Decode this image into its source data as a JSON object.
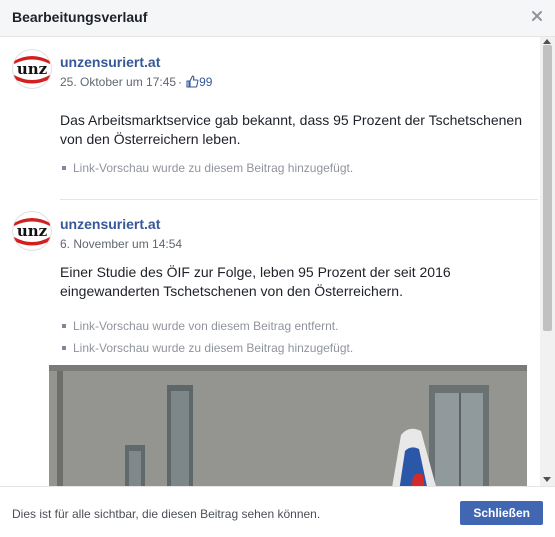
{
  "dialog": {
    "title": "Bearbeitungsverlauf",
    "footer_note": "Dies ist für alle sichtbar, die diesen Beitrag sehen können.",
    "close_label": "Schließen"
  },
  "entries": [
    {
      "author": "unzensuriert.at",
      "avatar_text": "unz",
      "date": "25. Oktober um 17:45",
      "separator": "·",
      "likes": "99",
      "text_lines": [
        "Das Arbeitsmarktservice gab bekannt, dass 95 Prozent der Tschetschenen",
        "von den Österreichern leben."
      ],
      "changes": [
        "Link-Vorschau wurde zu diesem Beitrag hinzugefügt."
      ]
    },
    {
      "author": "unzensuriert.at",
      "avatar_text": "unz",
      "date": "6. November um 14:54",
      "text_lines": [
        "Einer Studie des ÖIF zur Folge, leben 95 Prozent der seit 2016",
        "eingewanderten Tschetschenen von den Österreichern."
      ],
      "changes": [
        "Link-Vorschau wurde von diesem Beitrag entfernt.",
        "Link-Vorschau wurde zu diesem Beitrag hinzugefügt."
      ]
    }
  ],
  "colors": {
    "link": "#365899",
    "button": "#4267b2",
    "header_bg": "#f5f6f7",
    "avatar_red": "#d1201f"
  },
  "icons": {
    "close": "close-icon",
    "like": "thumbs-up-icon",
    "bullet": "square-bullet-icon"
  }
}
